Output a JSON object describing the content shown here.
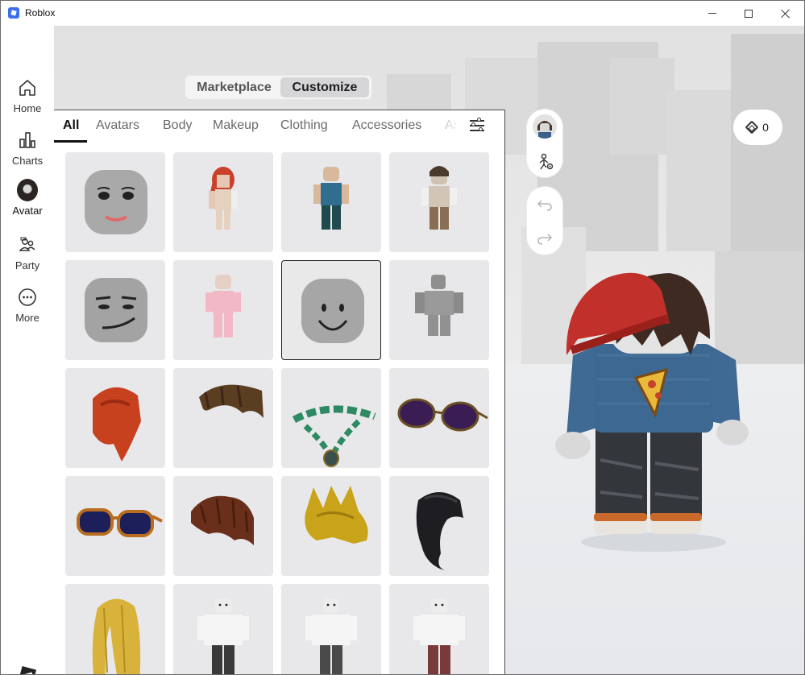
{
  "window": {
    "title": "Roblox"
  },
  "nav": {
    "items": [
      {
        "label": "Home",
        "icon": "home-icon"
      },
      {
        "label": "Charts",
        "icon": "charts-icon"
      },
      {
        "label": "Avatar",
        "icon": "avatar-icon"
      },
      {
        "label": "Party",
        "icon": "party-icon"
      },
      {
        "label": "More",
        "icon": "more-icon"
      }
    ]
  },
  "segmented": {
    "marketplace": "Marketplace",
    "customize": "Customize",
    "selected": "Customize"
  },
  "tabs": [
    {
      "label": "All",
      "active": true
    },
    {
      "label": "Avatars"
    },
    {
      "label": "Body"
    },
    {
      "label": "Makeup"
    },
    {
      "label": "Clothing"
    },
    {
      "label": "Accessories"
    },
    {
      "label": "An"
    }
  ],
  "robux": {
    "balance": "0"
  },
  "items": [
    {
      "kind": "smiling-face-head"
    },
    {
      "kind": "red-hair-girl-avatar"
    },
    {
      "kind": "blue-shirt-avatar"
    },
    {
      "kind": "brown-hair-avatar"
    },
    {
      "kind": "smirk-face-head"
    },
    {
      "kind": "pink-outfit-avatar"
    },
    {
      "kind": "smile-face-head",
      "selected": true
    },
    {
      "kind": "gray-blocky-avatar"
    },
    {
      "kind": "red-ponytail-hair"
    },
    {
      "kind": "brown-messy-hair"
    },
    {
      "kind": "green-bead-necklace"
    },
    {
      "kind": "aviator-sunglasses"
    },
    {
      "kind": "orange-sunglasses"
    },
    {
      "kind": "brown-spiky-hair"
    },
    {
      "kind": "blonde-spiky-hair"
    },
    {
      "kind": "black-long-hair"
    },
    {
      "kind": "blonde-long-hair"
    },
    {
      "kind": "white-shirt-avatar"
    },
    {
      "kind": "white-shirt-avatar"
    },
    {
      "kind": "white-shirt-avatar"
    }
  ]
}
